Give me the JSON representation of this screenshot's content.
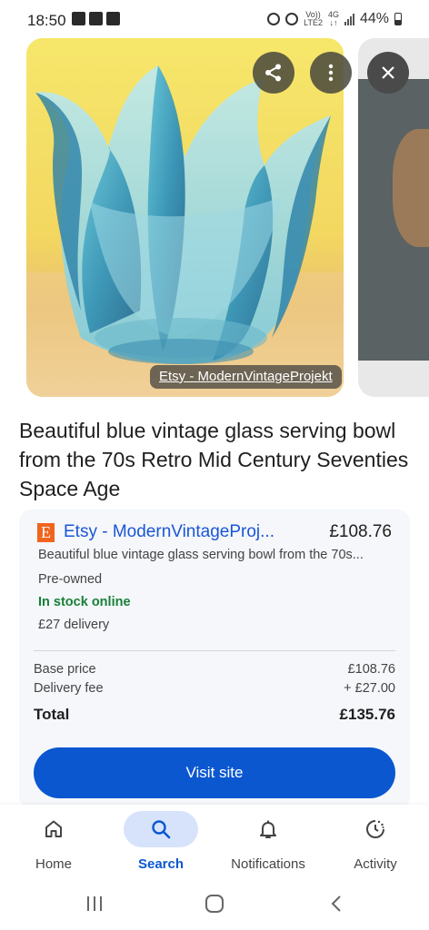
{
  "status_bar": {
    "time": "18:50",
    "network_top": "Vo))",
    "network_bottom": "LTE2",
    "gen_top": "4G",
    "gen_bottom": "↓↑",
    "battery": "44%"
  },
  "carousel": {
    "source_label": "Etsy - ModernVintageProjekt",
    "share_icon": "share-icon",
    "more_icon": "more-vert-icon",
    "close_icon": "close-icon"
  },
  "product": {
    "title": "Beautiful blue vintage glass serving bowl from the 70s Retro Mid Century Seventies Space Age"
  },
  "offer": {
    "logo_letter": "E",
    "seller": "Etsy - ModernVintageProj...",
    "price": "£108.76",
    "description": "Beautiful blue vintage glass serving bowl from the 70s...",
    "condition": "Pre-owned",
    "stock": "In stock online",
    "delivery": "£27 delivery",
    "base_price_label": "Base price",
    "base_price_value": "£108.76",
    "delivery_fee_label": "Delivery fee",
    "delivery_fee_value": "+ £27.00",
    "total_label": "Total",
    "total_value": "£135.76",
    "visit_label": "Visit site",
    "colors": {
      "link": "#1a56d6",
      "stock": "#188038",
      "button": "#0b57d0"
    }
  },
  "bottom_nav": [
    {
      "label": "Home",
      "icon": "home-icon",
      "active": false
    },
    {
      "label": "Search",
      "icon": "search-icon",
      "active": true
    },
    {
      "label": "Notifications",
      "icon": "bell-icon",
      "active": false
    },
    {
      "label": "Activity",
      "icon": "activity-icon",
      "active": false
    }
  ],
  "system_nav": {
    "recents_icon": "recents-icon",
    "home_icon": "system-home-icon",
    "back_icon": "back-icon"
  }
}
